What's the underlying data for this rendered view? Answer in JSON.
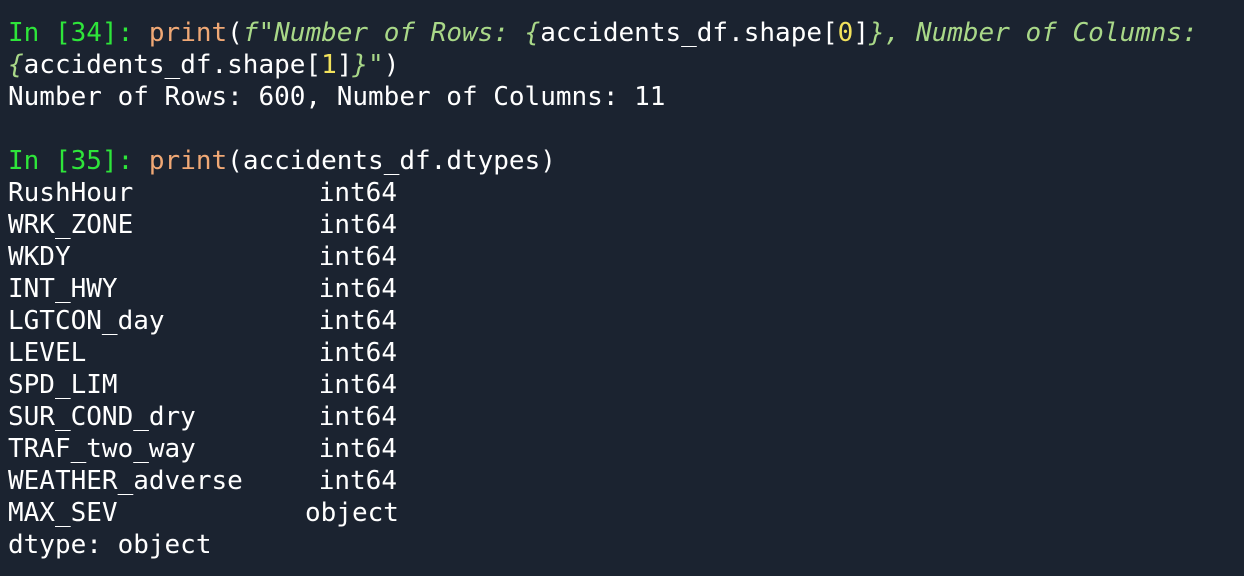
{
  "cells": [
    {
      "prompt": "In [34]:",
      "func": "print",
      "open_paren": "(",
      "fprefix": "f\"",
      "fstr_text1": "Number of Rows: ",
      "brace_open1": "{",
      "expr1": "accidents_df.shape[",
      "index1": "0",
      "expr1_close": "]",
      "brace_close1": "}",
      "fstr_text2": ", Number of Columns:",
      "brace_open2": "{",
      "expr2": "accidents_df.shape[",
      "index2": "1",
      "expr2_close": "]",
      "brace_close2": "}",
      "fsuffix": "\"",
      "close_paren": ")",
      "output": "Number of Rows: 600, Number of Columns: 11"
    },
    {
      "prompt": "In [35]:",
      "func": "print",
      "args": "(accidents_df.dtypes)",
      "dtypes": [
        {
          "name": "RushHour",
          "type": "int64"
        },
        {
          "name": "WRK_ZONE",
          "type": "int64"
        },
        {
          "name": "WKDY",
          "type": "int64"
        },
        {
          "name": "INT_HWY",
          "type": "int64"
        },
        {
          "name": "LGTCON_day",
          "type": "int64"
        },
        {
          "name": "LEVEL",
          "type": "int64"
        },
        {
          "name": "SPD_LIM",
          "type": "int64"
        },
        {
          "name": "SUR_COND_dry",
          "type": "int64"
        },
        {
          "name": "TRAF_two_way",
          "type": "int64"
        },
        {
          "name": "WEATHER_adverse",
          "type": "int64"
        },
        {
          "name": "MAX_SEV",
          "type": "object"
        }
      ],
      "footer": "dtype: object"
    }
  ],
  "colors": {
    "background": "#1b2330",
    "prompt": "#2ee53a",
    "function": "#f0a875",
    "fstring": "#a9d888",
    "number": "#f2e25c",
    "text": "#ffffff"
  }
}
